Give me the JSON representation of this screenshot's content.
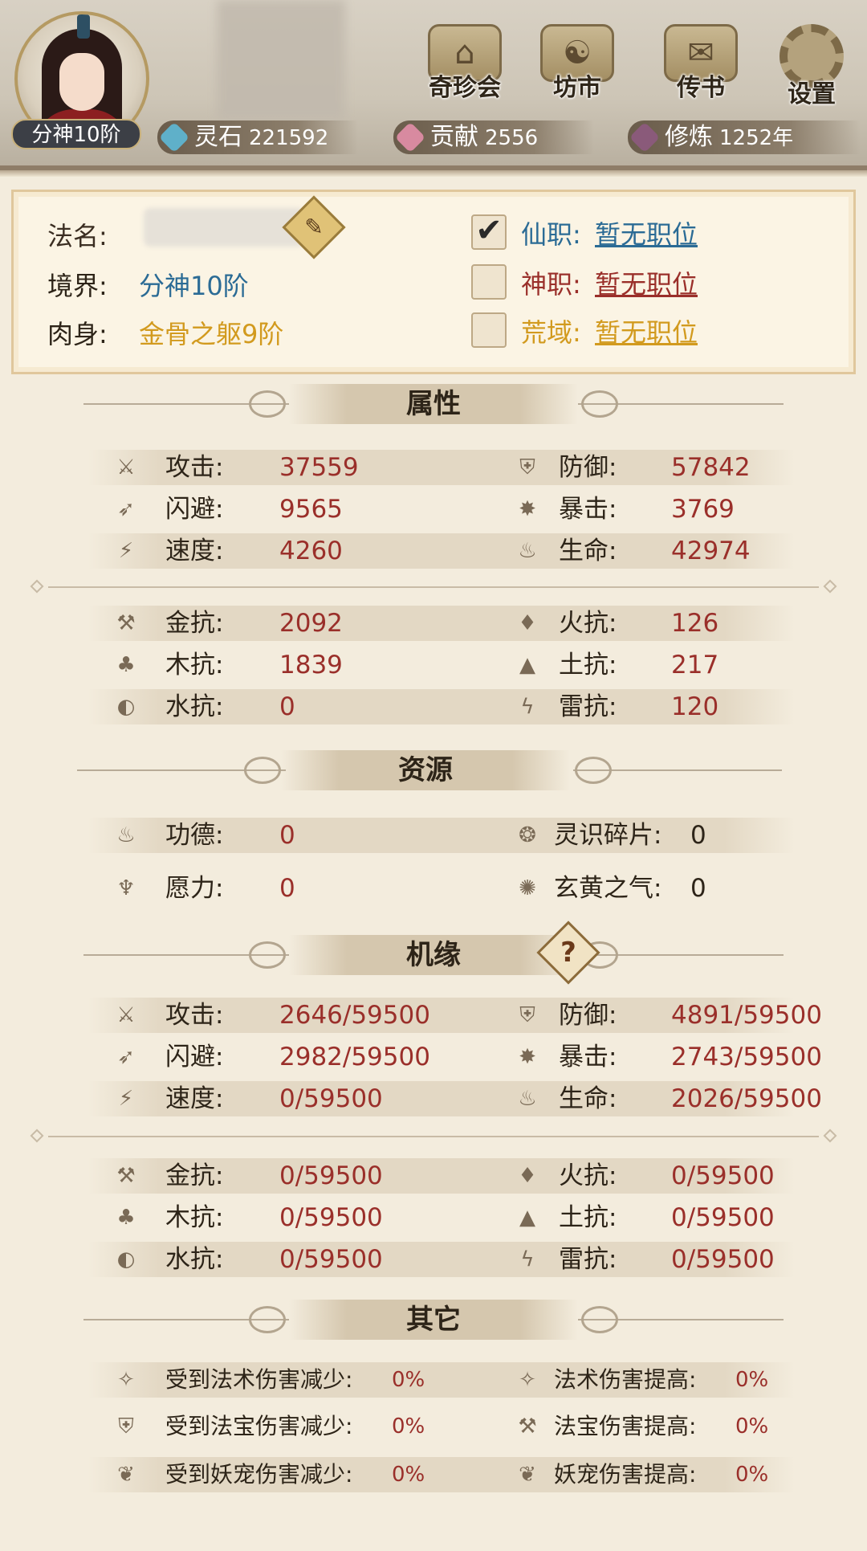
{
  "header": {
    "rank_badge": "分神10阶",
    "buttons": [
      {
        "label": "奇珍会",
        "icon": "pavilion-icon"
      },
      {
        "label": "坊市",
        "icon": "market-icon"
      },
      {
        "label": "传书",
        "icon": "scroll-icon"
      },
      {
        "label": "设置",
        "icon": "gear-icon"
      }
    ],
    "resources": [
      {
        "label": "灵石",
        "value": "221592",
        "color": "#5fb0c9"
      },
      {
        "label": "贡献",
        "value": "2556",
        "color": "#d88aa0"
      },
      {
        "label": "修炼",
        "value": "1252年",
        "color": "#8a5a7a"
      }
    ]
  },
  "profile": {
    "name_label": "法名:",
    "realm_label": "境界:",
    "realm_value": "分神10阶",
    "body_label": "肉身:",
    "body_value": "金骨之躯9阶",
    "brush_glyph": "✎",
    "positions": [
      {
        "label": "仙职:",
        "value": "暂无职位",
        "checked": true,
        "color": "#2b6b95"
      },
      {
        "label": "神职:",
        "value": "暂无职位",
        "checked": false,
        "color": "#9a2f2a"
      },
      {
        "label": "荒域:",
        "value": "暂无职位",
        "checked": false,
        "color": "#d29a1e"
      }
    ],
    "check_glyph": "✔"
  },
  "sections": {
    "attributes": "属性",
    "resources": "资源",
    "fortune": "机缘",
    "other": "其它"
  },
  "attributes": {
    "left": [
      {
        "label": "攻击:",
        "value": "37559",
        "icon": "attack-icon"
      },
      {
        "label": "闪避:",
        "value": "9565",
        "icon": "dodge-icon"
      },
      {
        "label": "速度:",
        "value": "4260",
        "icon": "speed-icon"
      }
    ],
    "right": [
      {
        "label": "防御:",
        "value": "57842",
        "icon": "defense-icon"
      },
      {
        "label": "暴击:",
        "value": "3769",
        "icon": "critical-icon"
      },
      {
        "label": "生命:",
        "value": "42974",
        "icon": "life-icon"
      }
    ],
    "res_left": [
      {
        "label": "金抗:",
        "value": "2092",
        "icon": "metal-resist-icon"
      },
      {
        "label": "木抗:",
        "value": "1839",
        "icon": "wood-resist-icon"
      },
      {
        "label": "水抗:",
        "value": "0",
        "icon": "water-resist-icon"
      }
    ],
    "res_right": [
      {
        "label": "火抗:",
        "value": "126",
        "icon": "fire-resist-icon"
      },
      {
        "label": "土抗:",
        "value": "217",
        "icon": "earth-resist-icon"
      },
      {
        "label": "雷抗:",
        "value": "120",
        "icon": "thunder-resist-icon"
      }
    ]
  },
  "resources": [
    {
      "label": "功德:",
      "value": "0",
      "icon": "merit-icon"
    },
    {
      "label": "灵识碎片:",
      "value": "0",
      "icon": "soul-fragment-icon"
    },
    {
      "label": "愿力:",
      "value": "0",
      "icon": "wish-power-icon"
    },
    {
      "label": "玄黄之气:",
      "value": "0",
      "icon": "xuanhuang-qi-icon"
    }
  ],
  "fortune": {
    "help_glyph": "?",
    "left": [
      {
        "label": "攻击:",
        "value": "2646/59500"
      },
      {
        "label": "闪避:",
        "value": "2982/59500"
      },
      {
        "label": "速度:",
        "value": "0/59500"
      }
    ],
    "right": [
      {
        "label": "防御:",
        "value": "4891/59500"
      },
      {
        "label": "暴击:",
        "value": "2743/59500"
      },
      {
        "label": "生命:",
        "value": "2026/59500"
      }
    ],
    "res_left": [
      {
        "label": "金抗:",
        "value": "0/59500"
      },
      {
        "label": "木抗:",
        "value": "0/59500"
      },
      {
        "label": "水抗:",
        "value": "0/59500"
      }
    ],
    "res_right": [
      {
        "label": "火抗:",
        "value": "0/59500"
      },
      {
        "label": "土抗:",
        "value": "0/59500"
      },
      {
        "label": "雷抗:",
        "value": "0/59500"
      }
    ]
  },
  "other": [
    {
      "label": "受到法术伤害减少:",
      "value": "0%"
    },
    {
      "label": "法术伤害提高:",
      "value": "0%"
    },
    {
      "label": "受到法宝伤害减少:",
      "value": "0%"
    },
    {
      "label": "法宝伤害提高:",
      "value": "0%"
    },
    {
      "label": "受到妖宠伤害减少:",
      "value": "0%"
    },
    {
      "label": "妖宠伤害提高:",
      "value": "0%"
    }
  ]
}
